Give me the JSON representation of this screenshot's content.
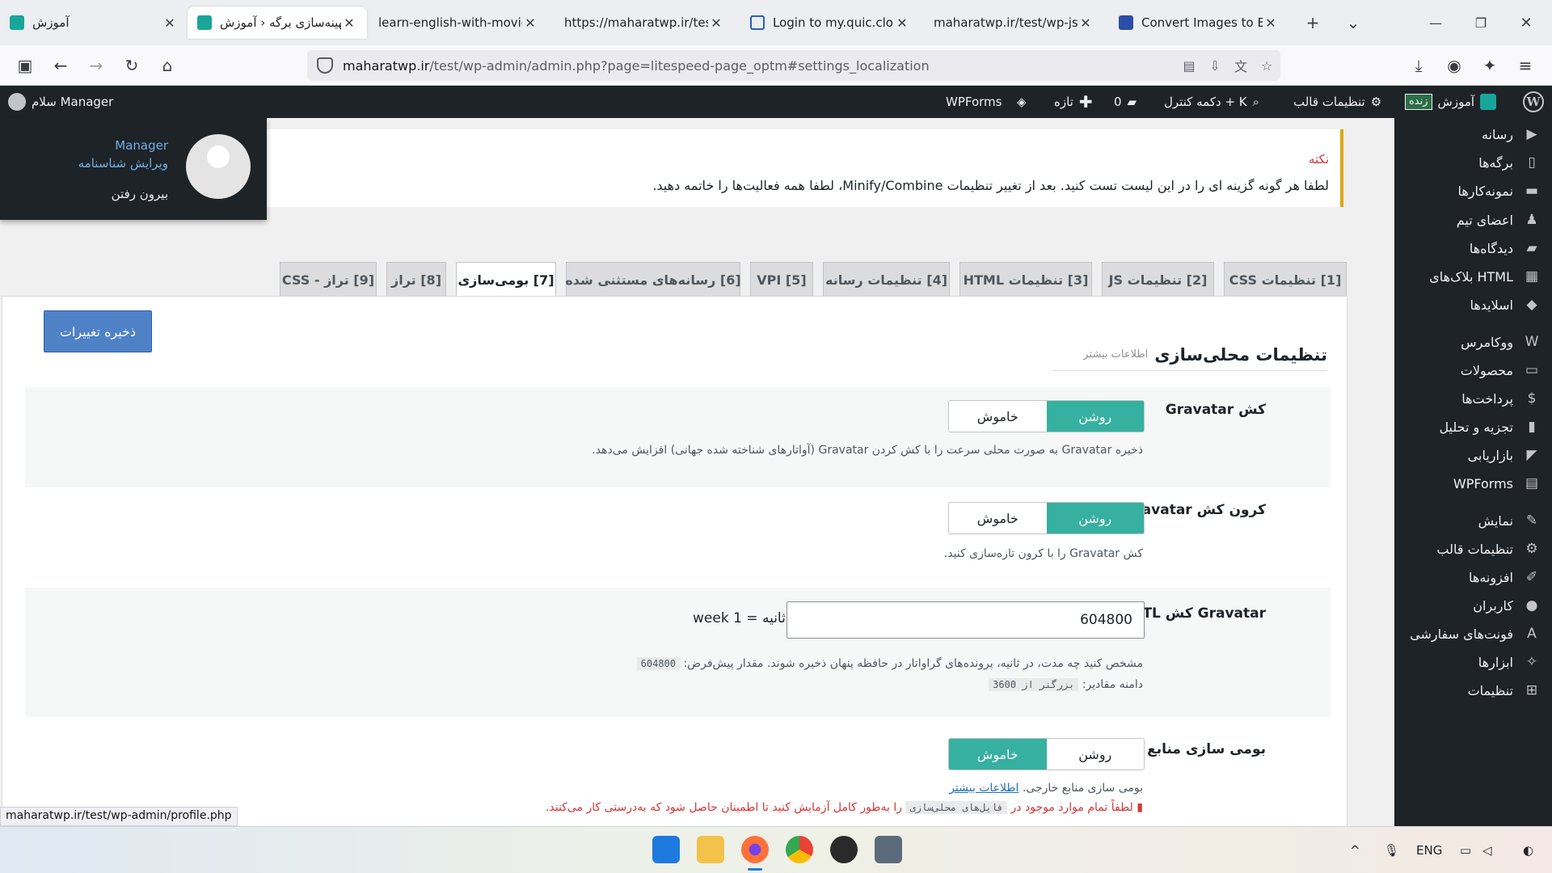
{
  "browser": {
    "tabs": [
      {
        "title": "آموزش",
        "active": false
      },
      {
        "title": "بهینه‌سازی برگه ‹ آموزش",
        "active": true
      },
      {
        "title": "learn-english-with-movies-",
        "active": false
      },
      {
        "title": "https://maharatwp.ir/test/",
        "active": false
      },
      {
        "title": "Login to my.quic.cloud |",
        "active": false
      },
      {
        "title": "maharatwp.ir/test/wp-json/",
        "active": false
      },
      {
        "title": "Convert Images to Base",
        "active": false
      }
    ],
    "new_tab": "+",
    "tab_list": "⌄",
    "minimize": "—",
    "restore": "❐",
    "close": "✕",
    "url_host": "maharatwp.ir",
    "url_path": "/test/wp-admin/admin.php?page=litespeed-page_optm#settings_localization",
    "status_link": "maharatwp.ir/test/wp-admin/profile.php"
  },
  "adminbar": {
    "site_name": "آموزش",
    "live_badge": "زنده",
    "theme_settings": "تنظیمات قالب",
    "control_button": "دکمه کنترل + K",
    "comments_count": "0",
    "new_label": "تازه",
    "wpforms": "WPForms",
    "greeting": "سلام Manager"
  },
  "user_dropdown": {
    "name": "Manager",
    "edit_profile": "ویرایش شناسنامه",
    "logout": "بیرون رفتن"
  },
  "sidebar": {
    "items": [
      {
        "label": "رسانه",
        "icon": "media-icon"
      },
      {
        "label": "برگه‌ها",
        "icon": "pages-icon"
      },
      {
        "label": "نمونه‌کارها",
        "icon": "portfolio-icon"
      },
      {
        "label": "اعضای تیم",
        "icon": "team-icon"
      },
      {
        "label": "دیدگاه‌ها",
        "icon": "comments-icon"
      },
      {
        "label": "بلاک‌های HTML",
        "icon": "html-blocks-icon"
      },
      {
        "label": "اسلایدها",
        "icon": "slides-icon"
      },
      {
        "label": "ووکامرس",
        "icon": "woocommerce-icon"
      },
      {
        "label": "محصولات",
        "icon": "products-icon"
      },
      {
        "label": "پرداخت‌ها",
        "icon": "payments-icon"
      },
      {
        "label": "تجزیه و تحلیل",
        "icon": "analytics-icon"
      },
      {
        "label": "بازاریابی",
        "icon": "marketing-icon"
      },
      {
        "label": "WPForms",
        "icon": "wpforms-icon"
      },
      {
        "label": "نمایش",
        "icon": "appearance-icon"
      },
      {
        "label": "تنظیمات قالب",
        "icon": "theme-settings-icon"
      },
      {
        "label": "افزونه‌ها",
        "icon": "plugins-icon"
      },
      {
        "label": "کاربران",
        "icon": "users-icon"
      },
      {
        "label": "فونت‌های سفارشی",
        "icon": "custom-fonts-icon"
      },
      {
        "label": "ابزارها",
        "icon": "tools-icon"
      },
      {
        "label": "تنظیمات",
        "icon": "settings-icon"
      }
    ]
  },
  "notice": {
    "title": "نکته",
    "text": "لطفا هر گونه گزینه ای را در این لیست تست کنید. بعد از تغییر تنظیمات Minify/Combine، لطفا همه فعالیت‌ها را خاتمه دهید."
  },
  "tabs": [
    {
      "label": "[1] تنظیمات CSS"
    },
    {
      "label": "[2] تنظیمات JS"
    },
    {
      "label": "[3] تنظیمات HTML"
    },
    {
      "label": "[4] تنظیمات رسانه"
    },
    {
      "label": "[5] VPI"
    },
    {
      "label": "[6] رسانه‌های مستثنی شده"
    },
    {
      "label": "[7] بومی‌سازی",
      "active": true
    },
    {
      "label": "[8] تراز"
    },
    {
      "label": "[9] تراز - CSS"
    }
  ],
  "panel": {
    "save_button": "ذخیره تغییرات",
    "section_title": "تنظیمات محلی‌سازی",
    "section_more": "اطلاعات بیشتر",
    "gravatar_cache": {
      "label": "کش Gravatar",
      "on": "روشن",
      "off": "خاموش",
      "selected": "on",
      "desc": "ذخیره Gravatar به صورت محلی سرعت را با کش کردن Gravatar (آواتارهای شناخته شده جهانی) افزایش می‌دهد."
    },
    "gravatar_cron": {
      "label": "کرون کش Gravatar",
      "on": "روشن",
      "off": "خاموش",
      "selected": "on",
      "desc": "کش Gravatar را با کرون تازه‌سازی کنید."
    },
    "gravatar_ttl": {
      "label": "Gravatar کش TTL",
      "value": "604800",
      "suffix": "ثانیه = 1 week",
      "desc_prefix": "مشخص کنید چه مدت، در ثانیه، پرونده‌های گراواتار در حافظه پنهان ذخیره شوند. مقدار پیش‌فرض:",
      "default_value": "604800",
      "range_prefix": "دامنه مقادیر:",
      "range_value": "بزرگتر از 3600"
    },
    "localize_resources": {
      "label": "بومی سازی منابع",
      "on": "روشن",
      "off": "خاموش",
      "selected": "off",
      "desc_prefix": "بومی سازی منابع خارجی.",
      "desc_link": "اطلاعات بیشتر",
      "warning_prefix": "لطفاً تمام موارد موجود در",
      "warning_code": "فایل‌های محلی‌سازی",
      "warning_suffix": "را به‌طور کامل آزمایش کنید تا اطمینان حاصل شود که به‌درستی کار می‌کنند."
    }
  },
  "taskbar": {
    "language": "ENG",
    "chevron": "^"
  }
}
